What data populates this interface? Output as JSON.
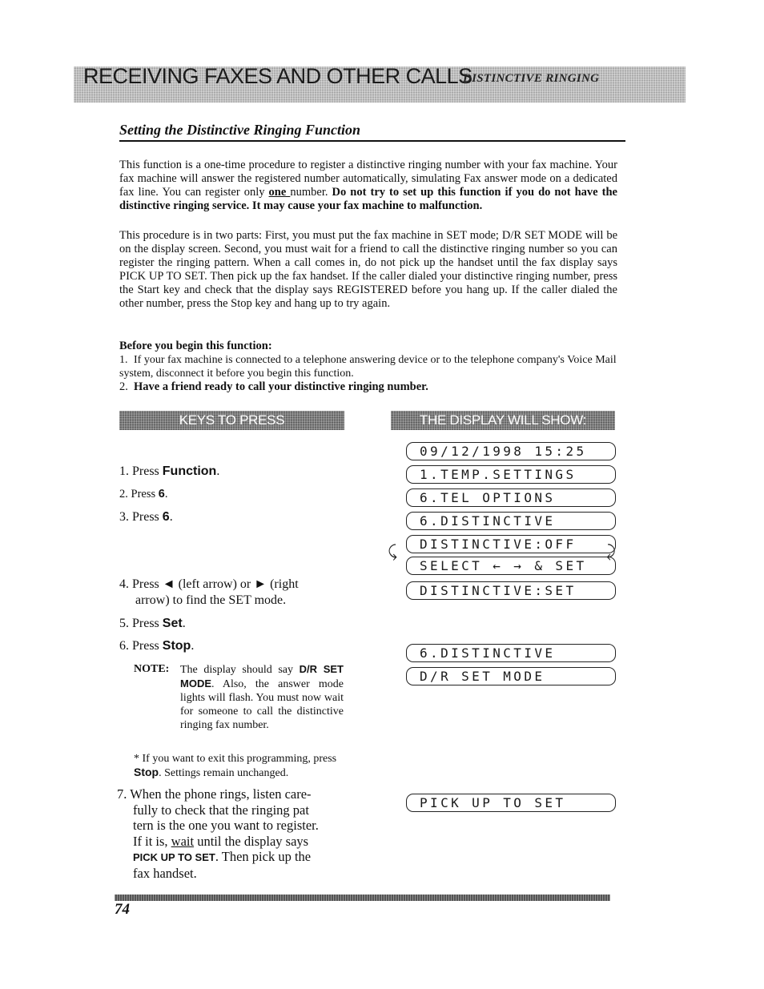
{
  "header": {
    "chapter_title": "RECEIVING FAXES AND OTHER CALLS",
    "section_tag": "DISTINCTIVE RINGING"
  },
  "section": {
    "title": "Setting the Distinctive Ringing Function"
  },
  "intro": {
    "p1_a": "This function is a one-time procedure to register a distinctive ringing number with your fax machine. Your fax machine will answer the registered number automatically, simulating Fax answer mode on a dedicated fax line. You can register only ",
    "p1_one": "one ",
    "p1_b": "number. ",
    "p1_bold": "Do not try to set up this function if you do not have the distinctive ringing service. It may cause your fax machine to malfunction.",
    "p2": "This procedure is in two parts: First, you must put the fax machine in SET mode; D/R SET MODE will be on the display screen. Second, you must wait for a friend to call the distinctive ringing number so you can register the ringing pattern. When a call comes in, do not pick up the handset until the fax display says PICK UP TO SET. Then pick up the fax handset. If the caller dialed your distinctive ringing number, press the Start key and check that the display says REGISTERED before you hang up. If the caller dialed the other number, press the Stop key and hang up to try again."
  },
  "before": {
    "title": "Before you begin this function:",
    "items": [
      {
        "num": "1.",
        "text": "If your fax machine is connected to a telephone answering device or to the telephone company's Voice Mail system, disconnect it before you begin this function."
      },
      {
        "num": "2.",
        "text": "Have a friend ready to call your distinctive ringing number."
      }
    ]
  },
  "columns": {
    "keys_header": "KEYS TO PRESS",
    "display_header": "THE DISPLAY WILL SHOW:"
  },
  "steps": [
    {
      "num": "1.",
      "pre": "Press ",
      "key": "Function",
      "post": "."
    },
    {
      "num": "2.",
      "pre": "Press ",
      "key": "6",
      "post": "."
    },
    {
      "num": "3.",
      "pre": "Press ",
      "key": "6",
      "post": "."
    },
    {
      "num": "4.",
      "pre": "Press ",
      "left_arrow": "◄",
      "mid1": " (left arrow) or ",
      "right_arrow": "►",
      "mid2": " (right",
      "cont": "arrow) to find the SET mode."
    },
    {
      "num": "5.",
      "pre": "Press ",
      "key": "Set",
      "post": "."
    },
    {
      "num": "6.",
      "pre": "Press ",
      "key": "Stop",
      "post": "."
    }
  ],
  "note": {
    "label": "NOTE:",
    "pre": "The display should say ",
    "key": "D/R SET MODE",
    "post": ". Also, the answer mode lights will flash. You must now wait for someone to call the distinctive ringing fax number."
  },
  "exit_note": {
    "pre": "* If you want to exit this programming, press ",
    "key": "Stop",
    "post": ". Settings remain unchanged."
  },
  "step7": {
    "num": "7.",
    "line1": "When the phone rings, listen care-",
    "line2": "fully to check that the ringing pat",
    "line3": "tern is the one you want to register.",
    "line4_pre": "If it is, ",
    "line4_u": "wait",
    "line4_post": " until the display says",
    "line5_key": "PICK UP TO SET",
    "line5_post": ". Then pick up the",
    "line6": "fax handset."
  },
  "displays": [
    "09/12/1998 15:25",
    "1.TEMP.SETTINGS",
    "6.TEL OPTIONS",
    "6.DISTINCTIVE",
    "DISTINCTIVE:OFF",
    "SELECT ← → & SET",
    "DISTINCTIVE:SET",
    "6.DISTINCTIVE",
    "D/R SET MODE",
    "PICK UP TO SET"
  ],
  "cycle_icons": {
    "left": "⤹",
    "right": "⤸"
  },
  "footer": {
    "page_number": "74"
  }
}
